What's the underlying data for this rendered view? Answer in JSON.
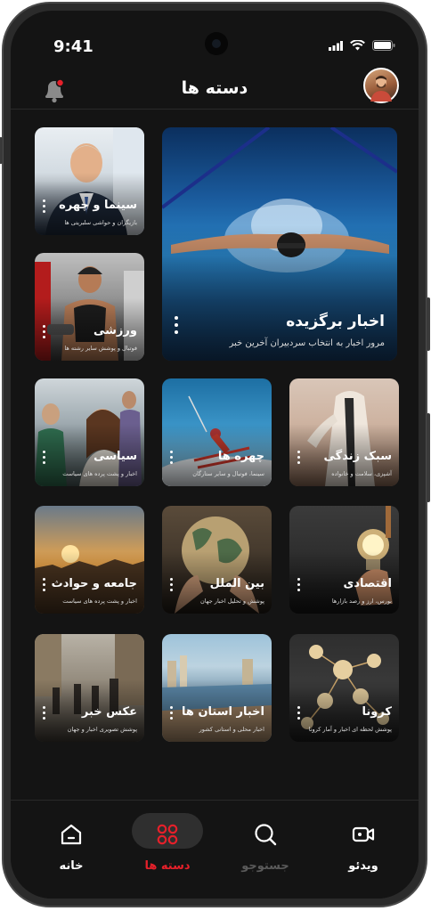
{
  "status": {
    "time": "9:41"
  },
  "header": {
    "title": "دسته ها"
  },
  "categories": [
    {
      "name": "اخبار برگزیده",
      "desc": "مرور اخبار به انتخاب سردبیران آخرین خبر"
    },
    {
      "name": "سینما و چهره",
      "desc": "بازیگران و حواشی سلبریتی ها"
    },
    {
      "name": "ورزشی",
      "desc": "فوتبال و پوشش سایر رشته ها"
    },
    {
      "name": "سبک زندگی",
      "desc": "آشپزی، سلامت و خانواده"
    },
    {
      "name": "چهره ها",
      "desc": "سینما، فوتبال و سایر ستارگان"
    },
    {
      "name": "سیاسی",
      "desc": "اخبار و پشت پرده های سیاست"
    },
    {
      "name": "اقتصادی",
      "desc": "بورس، ارز و رصد بازارها"
    },
    {
      "name": "بین الملل",
      "desc": "پوشش و تحلیل اخبار جهان"
    },
    {
      "name": "جامعه و حوادث",
      "desc": "اخبار و پشت پرده های سیاست"
    },
    {
      "name": "کرونا",
      "desc": "پوشش لحظه ای اخبار و آمار کرونا"
    },
    {
      "name": "اخبار استان ها",
      "desc": "اخبار محلی و استانی کشور"
    },
    {
      "name": "عکس خبر",
      "desc": "پوشش تصویری اخبار و جهان"
    }
  ],
  "nav": [
    {
      "label": "خانه"
    },
    {
      "label": "دسته ها"
    },
    {
      "label": "جستوجو"
    },
    {
      "label": "ویدئو"
    }
  ],
  "colors": {
    "accent": "#e5202a",
    "background": "#141414",
    "inactive": "#5a5a5a"
  }
}
